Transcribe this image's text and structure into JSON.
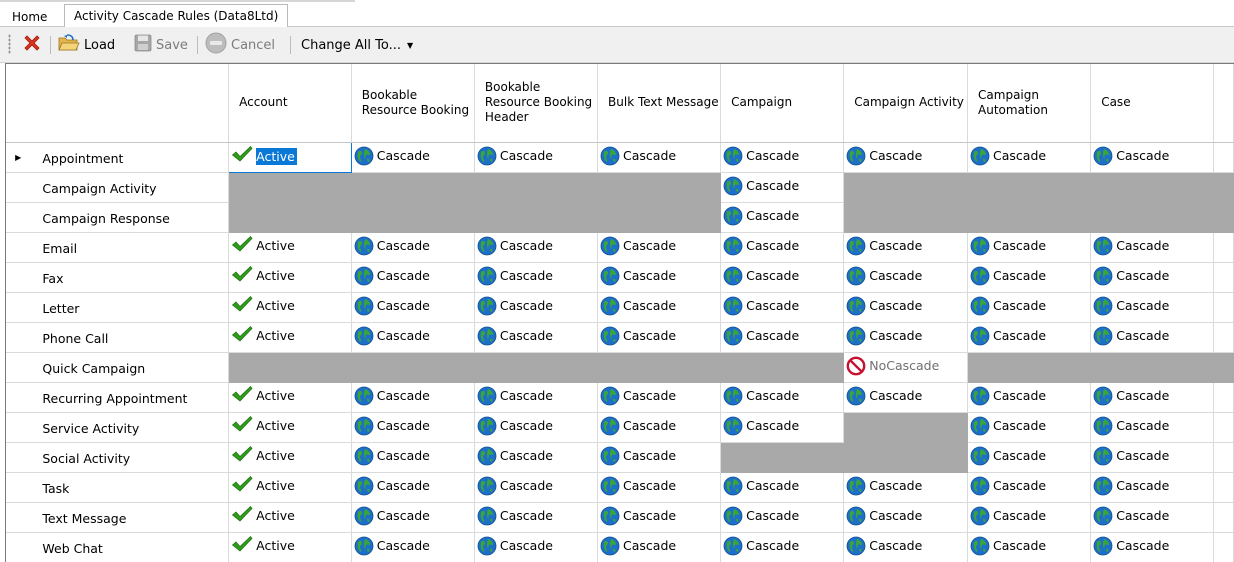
{
  "tabs": {
    "home": "Home",
    "active": "Activity Cascade Rules (Data8Ltd)"
  },
  "toolbar": {
    "load_label": "Load",
    "save_label": "Save",
    "cancel_label": "Cancel",
    "change_all_label": "Change All To..."
  },
  "columns": [
    "Account",
    "Bookable Resource Booking",
    "Bookable Resource Booking Header",
    "Bulk Text Message",
    "Campaign",
    "Campaign Activity",
    "Campaign Automation",
    "Case"
  ],
  "rows": [
    {
      "label": "Appointment",
      "current": true,
      "cells": [
        "Active",
        "Cascade",
        "Cascade",
        "Cascade",
        "Cascade",
        "Cascade",
        "Cascade",
        "Cascade"
      ]
    },
    {
      "label": "Campaign Activity",
      "cells": [
        "",
        "",
        "",
        "",
        "Cascade",
        "",
        "",
        ""
      ]
    },
    {
      "label": "Campaign Response",
      "cells": [
        "",
        "",
        "",
        "",
        "Cascade",
        "",
        "",
        ""
      ]
    },
    {
      "label": "Email",
      "cells": [
        "Active",
        "Cascade",
        "Cascade",
        "Cascade",
        "Cascade",
        "Cascade",
        "Cascade",
        "Cascade"
      ]
    },
    {
      "label": "Fax",
      "cells": [
        "Active",
        "Cascade",
        "Cascade",
        "Cascade",
        "Cascade",
        "Cascade",
        "Cascade",
        "Cascade"
      ]
    },
    {
      "label": "Letter",
      "cells": [
        "Active",
        "Cascade",
        "Cascade",
        "Cascade",
        "Cascade",
        "Cascade",
        "Cascade",
        "Cascade"
      ]
    },
    {
      "label": "Phone Call",
      "cells": [
        "Active",
        "Cascade",
        "Cascade",
        "Cascade",
        "Cascade",
        "Cascade",
        "Cascade",
        "Cascade"
      ]
    },
    {
      "label": "Quick Campaign",
      "cells": [
        "",
        "",
        "",
        "",
        "",
        "NoCascade",
        "",
        ""
      ]
    },
    {
      "label": "Recurring Appointment",
      "cells": [
        "Active",
        "Cascade",
        "Cascade",
        "Cascade",
        "Cascade",
        "Cascade",
        "Cascade",
        "Cascade"
      ]
    },
    {
      "label": "Service Activity",
      "cells": [
        "Active",
        "Cascade",
        "Cascade",
        "Cascade",
        "Cascade",
        "",
        "Cascade",
        "Cascade"
      ]
    },
    {
      "label": "Social Activity",
      "cells": [
        "Active",
        "Cascade",
        "Cascade",
        "Cascade",
        "",
        "",
        "Cascade",
        "Cascade"
      ]
    },
    {
      "label": "Task",
      "cells": [
        "Active",
        "Cascade",
        "Cascade",
        "Cascade",
        "Cascade",
        "Cascade",
        "Cascade",
        "Cascade"
      ]
    },
    {
      "label": "Text Message",
      "cells": [
        "Active",
        "Cascade",
        "Cascade",
        "Cascade",
        "Cascade",
        "Cascade",
        "Cascade",
        "Cascade"
      ]
    },
    {
      "label": "Web Chat",
      "cells": [
        "Active",
        "Cascade",
        "Cascade",
        "Cascade",
        "Cascade",
        "Cascade",
        "Cascade",
        "Cascade"
      ]
    }
  ],
  "selected_cell": {
    "row": 0,
    "col": 0
  },
  "icons": {
    "Active": "checkmark-icon",
    "Cascade": "globe-icon",
    "NoCascade": "no-entry-icon",
    "delete": "red-x-icon",
    "load": "folder-open-icon",
    "save": "floppy-disk-icon",
    "cancel": "stop-icon"
  },
  "colors": {
    "selection": "#0a78d7",
    "greyed_cell": "#a9a9a9",
    "check_green": "#2e9e1a",
    "globe_blue": "#1d6fc7",
    "globe_green": "#3aa53a",
    "no_entry_red": "#c8102e"
  }
}
